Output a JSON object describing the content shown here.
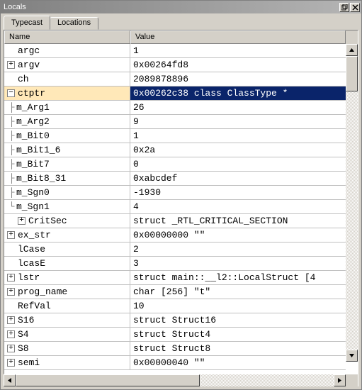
{
  "window": {
    "title": "Locals"
  },
  "tabs": [
    {
      "label": "Typecast",
      "active": true
    },
    {
      "label": "Locations",
      "active": false
    }
  ],
  "columns": {
    "name": "Name",
    "value": "Value"
  },
  "rows": [
    {
      "indent": 0,
      "ctrl": "none",
      "name": "argc",
      "value": "1"
    },
    {
      "indent": 0,
      "ctrl": "plus",
      "name": "argv",
      "value": "0x00264fd8"
    },
    {
      "indent": 0,
      "ctrl": "none",
      "name": "ch",
      "value": "2089878896"
    },
    {
      "indent": 0,
      "ctrl": "minus",
      "name": "ctptr",
      "value": "0x00262c38 class ClassType *",
      "selected": true
    },
    {
      "indent": 1,
      "ctrl": "branch",
      "name": "m_Arg1",
      "value": "26"
    },
    {
      "indent": 1,
      "ctrl": "branch",
      "name": "m_Arg2",
      "value": "9"
    },
    {
      "indent": 1,
      "ctrl": "branch",
      "name": "m_Bit0",
      "value": "1"
    },
    {
      "indent": 1,
      "ctrl": "branch",
      "name": "m_Bit1_6",
      "value": "0x2a"
    },
    {
      "indent": 1,
      "ctrl": "branch",
      "name": "m_Bit7",
      "value": "0"
    },
    {
      "indent": 1,
      "ctrl": "branch",
      "name": "m_Bit8_31",
      "value": "0xabcdef"
    },
    {
      "indent": 1,
      "ctrl": "branch",
      "name": "m_Sgn0",
      "value": "-1930"
    },
    {
      "indent": 1,
      "ctrl": "branchend",
      "name": "m_Sgn1",
      "value": "4"
    },
    {
      "indent": 1,
      "ctrl": "plus",
      "name": "CritSec",
      "value": "struct _RTL_CRITICAL_SECTION"
    },
    {
      "indent": 0,
      "ctrl": "plus",
      "name": "ex_str",
      "value": "0x00000000 \"\""
    },
    {
      "indent": 0,
      "ctrl": "none",
      "name": "lCase",
      "value": "2"
    },
    {
      "indent": 0,
      "ctrl": "none",
      "name": "lcasE",
      "value": "3"
    },
    {
      "indent": 0,
      "ctrl": "plus",
      "name": "lstr",
      "value": "struct main::__l2::LocalStruct [4"
    },
    {
      "indent": 0,
      "ctrl": "plus",
      "name": "prog_name",
      "value": "char [256] \"t\""
    },
    {
      "indent": 0,
      "ctrl": "none",
      "name": "RefVal",
      "value": "10"
    },
    {
      "indent": 0,
      "ctrl": "plus",
      "name": "S16",
      "value": "struct Struct16"
    },
    {
      "indent": 0,
      "ctrl": "plus",
      "name": "S4",
      "value": "struct Struct4"
    },
    {
      "indent": 0,
      "ctrl": "plus",
      "name": "S8",
      "value": "struct Struct8"
    },
    {
      "indent": 0,
      "ctrl": "plus",
      "name": "semi",
      "value": "0x00000040 \"\""
    }
  ]
}
